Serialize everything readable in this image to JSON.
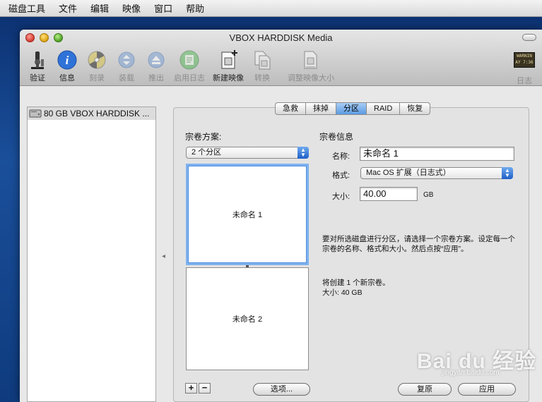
{
  "menubar": {
    "items": [
      "磁盘工具",
      "文件",
      "编辑",
      "映像",
      "窗口",
      "帮助"
    ]
  },
  "window": {
    "title": "VBOX HARDDISK Media"
  },
  "toolbar": {
    "verify": "验证",
    "info": "信息",
    "burn": "刻录",
    "mount": "装载",
    "eject": "推出",
    "enable_journal": "启用日志",
    "new_image": "新建映像",
    "convert": "转换",
    "resize_image": "调整映像大小",
    "log": "日志",
    "log_icon_text": "WARNIN AY 7:36"
  },
  "sidebar": {
    "items": [
      {
        "label": "80 GB VBOX HARDDISK ..."
      }
    ]
  },
  "tabs": {
    "first_aid": "急救",
    "erase": "抹掉",
    "partition": "分区",
    "raid": "RAID",
    "restore": "恢复"
  },
  "partition": {
    "scheme_label": "宗卷方案:",
    "scheme_value": "2 个分区",
    "partitions": [
      "未命名 1",
      "未命名 2"
    ],
    "add_symbol": "+",
    "remove_symbol": "−",
    "options_button": "选项..."
  },
  "volume_info": {
    "heading": "宗卷信息",
    "name_label": "名称:",
    "name_value": "未命名 1",
    "format_label": "格式:",
    "format_value": "Mac OS 扩展（日志式）",
    "size_label": "大小:",
    "size_value": "40.00",
    "size_unit": "GB",
    "description": "要对所选磁盘进行分区，请选择一个宗卷方案。设定每一个宗卷的名称、格式和大小。然后点按“应用”。",
    "summary_line1": "将创建 1 个新宗卷。",
    "summary_line2": "大小: 40 GB",
    "revert_button": "复原",
    "apply_button": "应用"
  },
  "watermark": {
    "text": "Bai du 经验",
    "sub": "jingyan.baidu.com"
  }
}
